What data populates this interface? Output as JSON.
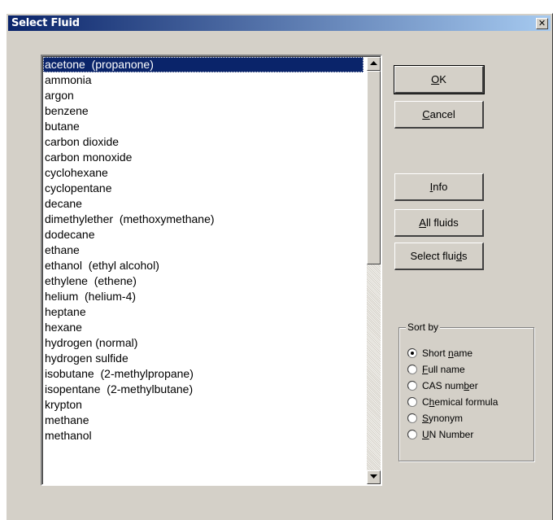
{
  "window": {
    "title": "Select Fluid"
  },
  "fluids": [
    "acetone  (propanone)",
    "ammonia",
    "argon",
    "benzene",
    "butane",
    "carbon dioxide",
    "carbon monoxide",
    "cyclohexane",
    "cyclopentane",
    "decane",
    "dimethylether  (methoxymethane)",
    "dodecane",
    "ethane",
    "ethanol  (ethyl alcohol)",
    "ethylene  (ethene)",
    "helium  (helium-4)",
    "heptane",
    "hexane",
    "hydrogen (normal)",
    "hydrogen sulfide",
    "isobutane  (2-methylpropane)",
    "isopentane  (2-methylbutane)",
    "krypton",
    "methane",
    "methanol"
  ],
  "selected_fluid": "acetone  (propanone)",
  "buttons": {
    "ok": {
      "pre": "",
      "mn": "O",
      "post": "K"
    },
    "cancel": {
      "pre": "",
      "mn": "C",
      "post": "ancel"
    },
    "info": {
      "pre": "",
      "mn": "I",
      "post": "nfo"
    },
    "all_fluids": {
      "pre": "",
      "mn": "A",
      "post": "ll fluids"
    },
    "select_fluids": {
      "pre": "Select flui",
      "mn": "d",
      "post": "s"
    }
  },
  "sort": {
    "legend": "Sort by",
    "selected": "Short name",
    "options": [
      {
        "pre": "Short ",
        "mn": "n",
        "post": "ame"
      },
      {
        "pre": "",
        "mn": "F",
        "post": "ull name"
      },
      {
        "pre": "CAS num",
        "mn": "b",
        "post": "er"
      },
      {
        "pre": "C",
        "mn": "h",
        "post": "emical formula"
      },
      {
        "pre": "",
        "mn": "S",
        "post": "ynonym"
      },
      {
        "pre": "",
        "mn": "U",
        "post": "N Number"
      }
    ]
  },
  "colors": {
    "selection": "#0a246a",
    "face": "#d4d0c8",
    "titlebar_start": "#0a246a",
    "titlebar_end": "#a6caf0"
  }
}
